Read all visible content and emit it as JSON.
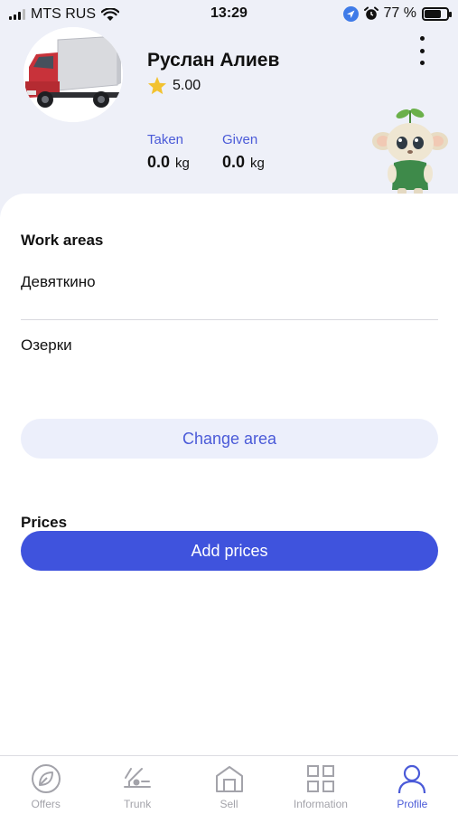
{
  "status_bar": {
    "carrier": "MTS RUS",
    "time": "13:29",
    "battery_percent": "77 %",
    "battery_level": 0.77
  },
  "profile": {
    "name": "Руслан Алиев",
    "rating": "5.00",
    "avatar_icon": "truck-avatar",
    "stats": {
      "taken_label": "Taken",
      "taken_value": "0.0",
      "taken_unit": "kg",
      "given_label": "Given",
      "given_value": "0.0",
      "given_unit": "kg"
    }
  },
  "work_areas": {
    "title": "Work areas",
    "items": [
      "Девяткино",
      "Озерки"
    ],
    "change_button": "Change area"
  },
  "prices": {
    "title": "Prices",
    "add_button": "Add prices"
  },
  "tab_bar": {
    "items": [
      {
        "label": "Offers",
        "icon": "offers-icon",
        "active": false
      },
      {
        "label": "Trunk",
        "icon": "trunk-icon",
        "active": false
      },
      {
        "label": "Sell",
        "icon": "sell-icon",
        "active": false
      },
      {
        "label": "Information",
        "icon": "grid-icon",
        "active": false
      },
      {
        "label": "Profile",
        "icon": "profile-icon",
        "active": true
      }
    ]
  },
  "colors": {
    "accent": "#3f53dd",
    "accent_text": "#4a5ad8",
    "header_bg": "#eef0f8",
    "secondary_button_bg": "#eceffb",
    "star": "#f2c230"
  }
}
